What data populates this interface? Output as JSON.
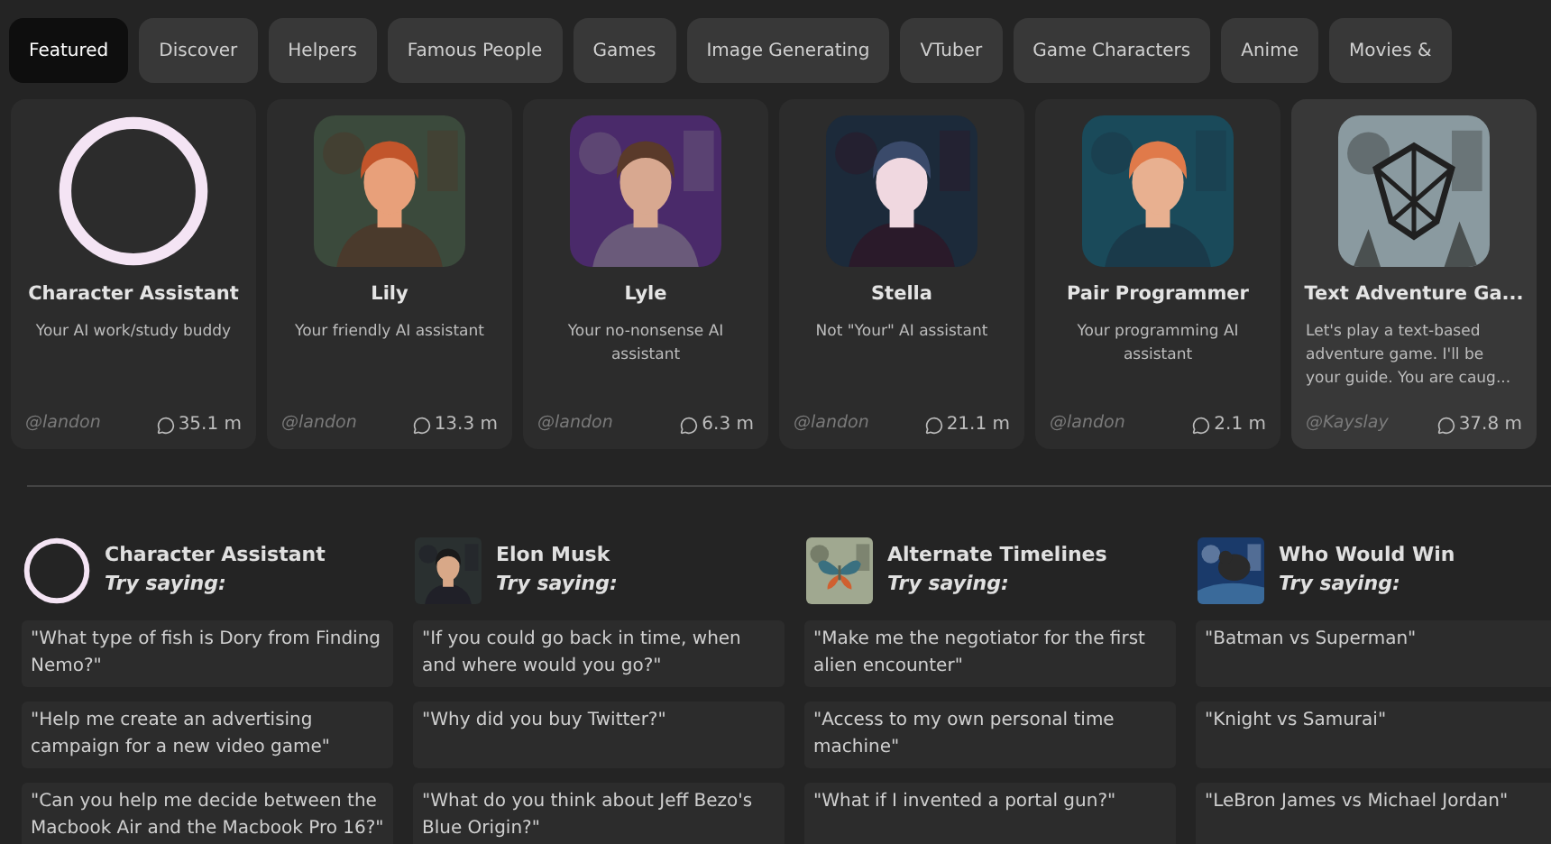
{
  "tabs": [
    {
      "label": "Featured",
      "selected": true
    },
    {
      "label": "Discover",
      "selected": false
    },
    {
      "label": "Helpers",
      "selected": false
    },
    {
      "label": "Famous People",
      "selected": false
    },
    {
      "label": "Games",
      "selected": false
    },
    {
      "label": "Image Generating",
      "selected": false
    },
    {
      "label": "VTuber",
      "selected": false
    },
    {
      "label": "Game Characters",
      "selected": false
    },
    {
      "label": "Anime",
      "selected": false
    },
    {
      "label": "Movies &",
      "selected": false
    }
  ],
  "featured_cards": [
    {
      "name": "Character Assistant",
      "description": "Your AI work/study buddy",
      "author": "@landon",
      "chats": "35.1 m",
      "avatar": {
        "kind": "ring"
      },
      "highlighted": false
    },
    {
      "name": "Lily",
      "description": "Your friendly AI assistant",
      "author": "@landon",
      "chats": "13.3 m",
      "avatar": {
        "kind": "picture"
      },
      "highlighted": false
    },
    {
      "name": "Lyle",
      "description": "Your no-nonsense AI assistant",
      "author": "@landon",
      "chats": "6.3 m",
      "avatar": {
        "kind": "picture"
      },
      "highlighted": false
    },
    {
      "name": "Stella",
      "description": "Not \"Your\" AI assistant",
      "author": "@landon",
      "chats": "21.1 m",
      "avatar": {
        "kind": "picture"
      },
      "highlighted": false
    },
    {
      "name": "Pair Programmer",
      "description": "Your programming AI assistant",
      "author": "@landon",
      "chats": "2.1 m",
      "avatar": {
        "kind": "picture"
      },
      "highlighted": false
    },
    {
      "name": "Text Adventure Ga...",
      "description": "Let's play a text-based adventure game. I'll be your guide. You are caug...",
      "author": "@Kayslay",
      "chats": "37.8 m",
      "avatar": {
        "kind": "picture"
      },
      "highlighted": true
    }
  ],
  "suggestions": [
    {
      "name": "Character Assistant",
      "prompt_label": "Try saying:",
      "avatar": {
        "kind": "ring"
      },
      "examples": [
        "\"What type of fish is Dory from Finding Nemo?\"",
        "\"Help me create an advertising campaign for a new video game\"",
        "\"Can you help me decide between the Macbook Air and the Macbook Pro 16?\""
      ]
    },
    {
      "name": "Elon Musk",
      "prompt_label": "Try saying:",
      "avatar": {
        "kind": "picture"
      },
      "examples": [
        "\"If you could go back in time, when and where would you go?\"",
        "\"Why did you buy Twitter?\"",
        "\"What do you think about Jeff Bezo's Blue Origin?\""
      ]
    },
    {
      "name": "Alternate Timelines",
      "prompt_label": "Try saying:",
      "avatar": {
        "kind": "picture"
      },
      "examples": [
        "\"Make me the negotiator for the first alien encounter\"",
        "\"Access to my own personal time machine\"",
        "\"What if I invented a portal gun?\""
      ]
    },
    {
      "name": "Who Would Win",
      "prompt_label": "Try saying:",
      "avatar": {
        "kind": "picture"
      },
      "examples": [
        "\"Batman vs Superman\"",
        "\"Knight vs Samurai\"",
        "\"LeBron James vs Michael Jordan\""
      ]
    }
  ]
}
